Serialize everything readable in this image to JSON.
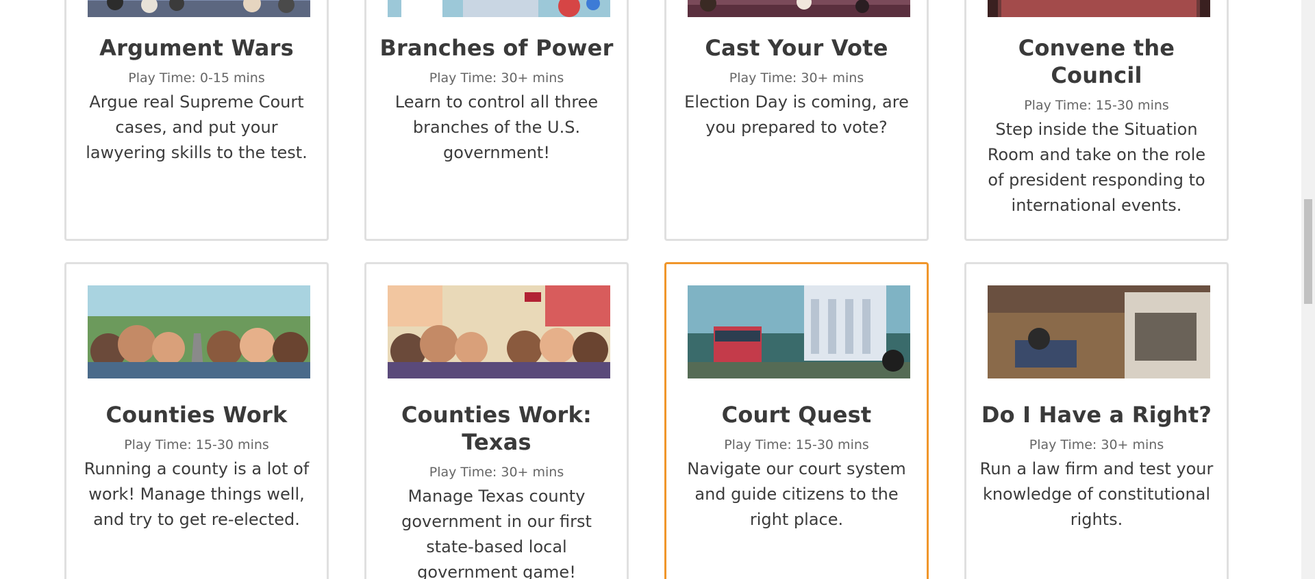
{
  "top_row": [
    {
      "title": "Argument Wars",
      "play_time": "Play Time: 0-15 mins",
      "description": "Argue real Supreme Court cases, and put your lawyering skills to the test."
    },
    {
      "title": "Branches of Power",
      "play_time": "Play Time: 30+ mins",
      "description": "Learn to control all three branches of the U.S. government!"
    },
    {
      "title": "Cast Your Vote",
      "play_time": "Play Time: 30+ mins",
      "description": "Election Day is coming, are you prepared to vote?"
    },
    {
      "title": "Convene the Council",
      "play_time": "Play Time: 15-30 mins",
      "description": "Step inside the Situation Room and take on the role of president responding to international events."
    }
  ],
  "bottom_row": [
    {
      "title": "Counties Work",
      "play_time": "Play Time: 15-30 mins",
      "description": "Running a county is a lot of work! Manage things well, and try to get re-elected.",
      "image_icon": "counties-work-thumbnail"
    },
    {
      "title": "Counties Work: Texas",
      "play_time": "Play Time: 30+ mins",
      "description": "Manage Texas county government in our first state-based local government game!",
      "image_icon": "counties-work-texas-thumbnail"
    },
    {
      "title": "Court Quest",
      "play_time": "Play Time: 15-30 mins",
      "description": "Navigate our court system and guide citizens to the right place.",
      "image_icon": "court-quest-thumbnail"
    },
    {
      "title": "Do I Have a Right?",
      "play_time": "Play Time: 30+ mins",
      "description": "Run a law firm and test your knowledge of constitutional rights.",
      "image_icon": "do-i-have-a-right-thumbnail"
    }
  ],
  "colors": {
    "card_border": "#e0e0e0",
    "highlight_border": "#f0962b",
    "title_text": "#3a3a3a",
    "meta_text": "#666666"
  }
}
